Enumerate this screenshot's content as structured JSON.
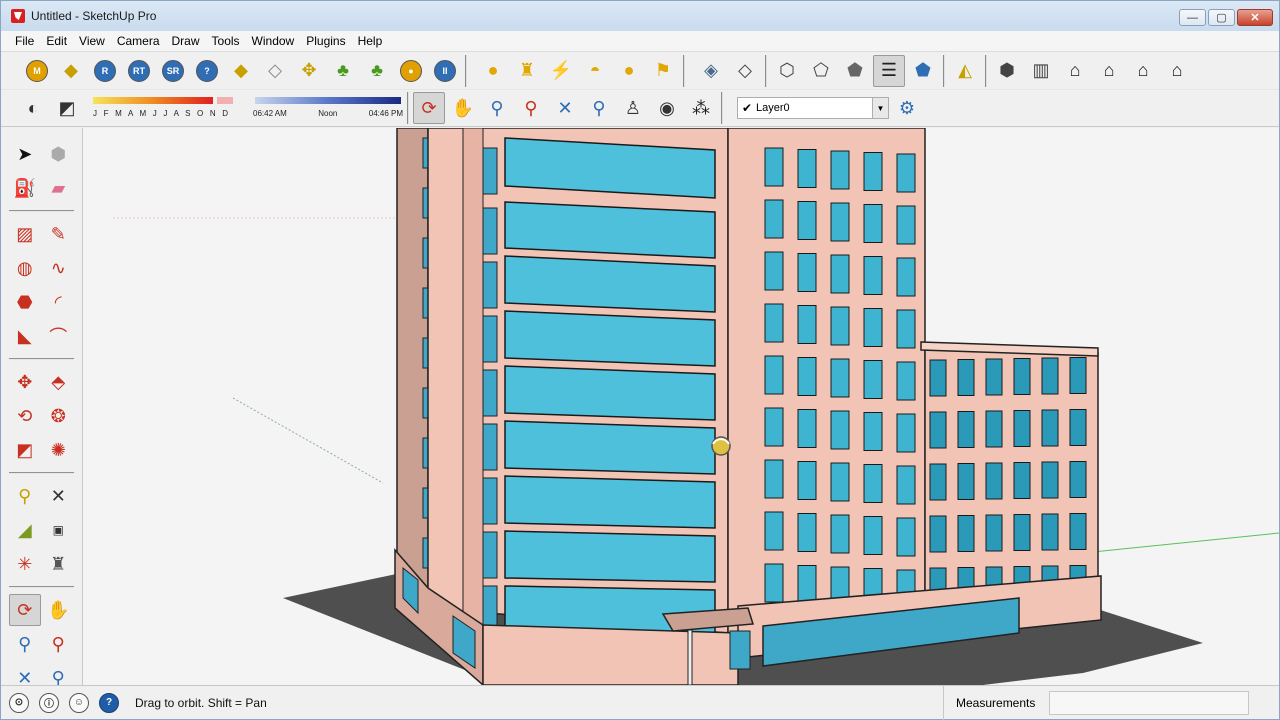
{
  "window": {
    "title": "Untitled - SketchUp Pro",
    "minimize": "—",
    "maximize": "▢",
    "close": "✕"
  },
  "menu": [
    "File",
    "Edit",
    "View",
    "Camera",
    "Draw",
    "Tools",
    "Window",
    "Plugins",
    "Help"
  ],
  "shadows": {
    "months": "J F M A M J J A S O N D",
    "time_start": "06:42 AM",
    "time_noon": "Noon",
    "time_end": "04:46 PM"
  },
  "layer": {
    "current": "Layer0",
    "check": "✔",
    "arrow": "▼"
  },
  "status": {
    "hint": "Drag to orbit.  Shift = Pan",
    "measurements_label": "Measurements",
    "measurements_value": ""
  },
  "colors": {
    "glass": "#4fc0db",
    "wall": "#f2c4b6",
    "shadow": "#505050",
    "ground": "#f4f4f4",
    "accent_blue": "#1f5da8"
  }
}
